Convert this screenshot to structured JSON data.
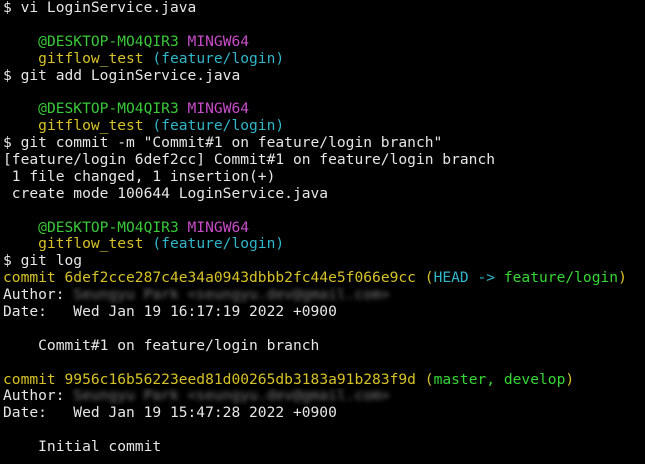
{
  "prompt_symbol": "$ ",
  "prompt": {
    "userhost": "@DESKTOP-MO4QIR3",
    "env": "MINGW64",
    "path": "gitflow_test",
    "branch": "(feature/login)"
  },
  "commands": {
    "vi": "vi LoginService.java",
    "add": "git add LoginService.java",
    "commit": "git commit -m \"Commit#1 on feature/login branch\"",
    "log": "git log"
  },
  "commit_output": {
    "line1": "[feature/login 6def2cc] Commit#1 on feature/login branch",
    "line2": " 1 file changed, 1 insertion(+)",
    "line3": " create mode 100644 LoginService.java"
  },
  "log": {
    "commit_word": "commit ",
    "author_label": "Author: ",
    "date_label": "Date:   ",
    "commits": [
      {
        "hash": "6def2cce287c4e34a0943dbbb2fc44e5f066e9cc",
        "refs_open": "(",
        "head_ref": "HEAD -> ",
        "branch_ref": "feature/login",
        "refs_close": ")",
        "author_redacted": "Seungyu Park <seungyu.dev@gmail.com>",
        "date": "Wed Jan 19 16:17:19 2022 +0900",
        "message": "    Commit#1 on feature/login branch"
      },
      {
        "hash": "9956c16b56223eed81d00265db3183a91b283f9d",
        "refs_open": "(",
        "branch_ref": "master, develop",
        "refs_close": ")",
        "author_redacted": "Seungyu Park <seungyu.dev@gmail.com>",
        "date": "Wed Jan 19 15:47:28 2022 +0900",
        "message": "    Initial commit"
      }
    ]
  },
  "colors": {
    "background": "#000000",
    "text": "#e6e6e6",
    "userhost": "#39c939",
    "env": "#c94cc9",
    "path": "#d6c227",
    "branch": "#31b6c9",
    "commit_hash": "#d6c227",
    "ref_branch": "#35d735"
  }
}
